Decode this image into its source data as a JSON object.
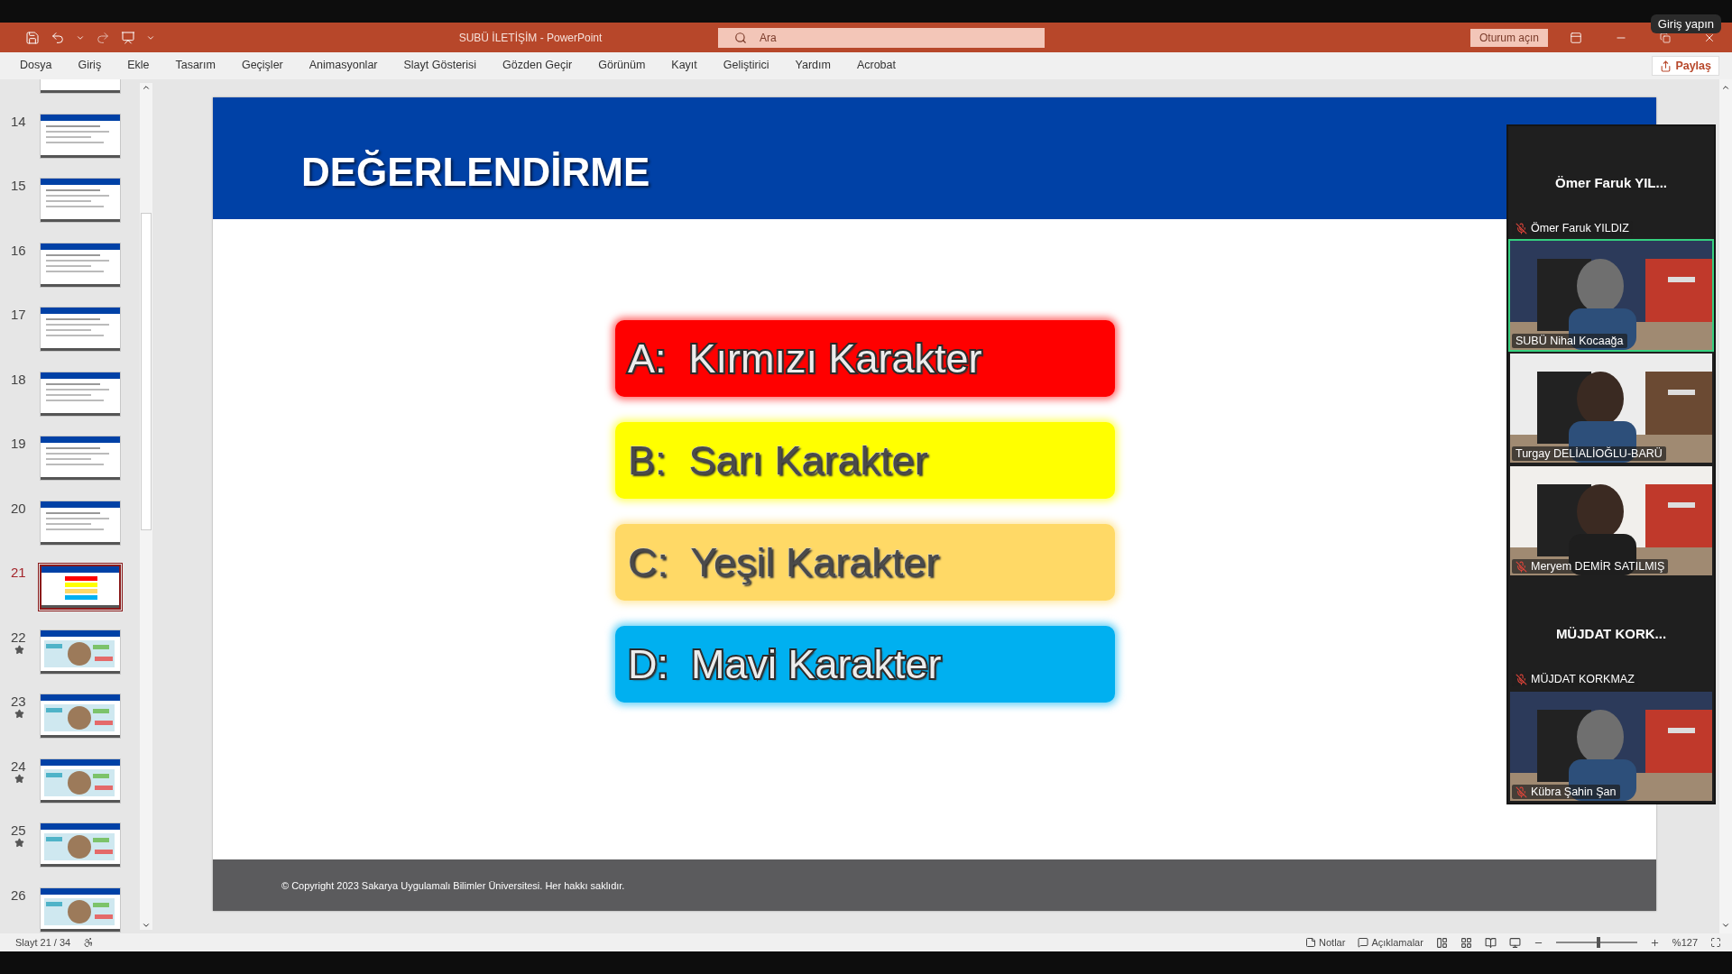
{
  "window": {
    "title": "SUBÜ İLETİŞİM  -  PowerPoint"
  },
  "search": {
    "placeholder": "Ara"
  },
  "sign_in_button": "Oturum açın",
  "tooltip": "Giriş yapın",
  "ribbon_tabs": [
    {
      "label": "Dosya",
      "selected": false
    },
    {
      "label": "Giriş",
      "selected": false
    },
    {
      "label": "Ekle",
      "selected": false
    },
    {
      "label": "Tasarım",
      "selected": false
    },
    {
      "label": "Geçişler",
      "selected": false
    },
    {
      "label": "Animasyonlar",
      "selected": false
    },
    {
      "label": "Slayt Gösterisi",
      "selected": false
    },
    {
      "label": "Gözden Geçir",
      "selected": false
    },
    {
      "label": "Görünüm",
      "selected": false
    },
    {
      "label": "Kayıt",
      "selected": false
    },
    {
      "label": "Geliştirici",
      "selected": false
    },
    {
      "label": "Yardım",
      "selected": false
    },
    {
      "label": "Acrobat",
      "selected": false
    }
  ],
  "share_button": "Paylaş",
  "thumbnails": [
    {
      "kind": "text",
      "selected": false,
      "starred": false
    },
    {
      "number": "14",
      "kind": "text",
      "selected": false,
      "starred": false
    },
    {
      "number": "15",
      "kind": "text",
      "selected": false,
      "starred": false
    },
    {
      "number": "16",
      "kind": "text",
      "selected": false,
      "starred": false
    },
    {
      "number": "17",
      "kind": "text",
      "selected": false,
      "starred": false
    },
    {
      "number": "18",
      "kind": "text",
      "selected": false,
      "starred": false
    },
    {
      "number": "19",
      "kind": "text",
      "selected": false,
      "starred": false
    },
    {
      "number": "20",
      "kind": "text",
      "selected": false,
      "starred": false
    },
    {
      "number": "21",
      "kind": "options",
      "selected": true,
      "starred": false
    },
    {
      "number": "22",
      "kind": "picture",
      "selected": false,
      "starred": true
    },
    {
      "number": "23",
      "kind": "picture",
      "selected": false,
      "starred": true
    },
    {
      "number": "24",
      "kind": "picture",
      "selected": false,
      "starred": true
    },
    {
      "number": "25",
      "kind": "picture",
      "selected": false,
      "starred": true
    },
    {
      "number": "26",
      "kind": "picture",
      "selected": false,
      "starred": false
    }
  ],
  "slide": {
    "title": "DEĞERLENDİRME",
    "options": [
      {
        "label": "A:  Kırmızı Karakter",
        "color": "#ff0000"
      },
      {
        "label": "B:  Sarı Karakter",
        "color": "#ffff00"
      },
      {
        "label": "C:  Yeşil Karakter",
        "color": "#ffd966"
      },
      {
        "label": "D:  Mavi Karakter",
        "color": "#00b0f0"
      }
    ],
    "footer": "© Copyright 2023 Sakarya Uygulamalı Bilimler Üniversitesi. Her hakkı saklıdır."
  },
  "participants": [
    {
      "kind": "name",
      "display": "Ömer Faruk YIL...",
      "name": "Ömer Faruk YILDIZ",
      "muted": true,
      "speaking": false
    },
    {
      "kind": "video",
      "name": "SUBÜ Nihal Kocaağa",
      "muted": false,
      "speaking": true
    },
    {
      "kind": "video",
      "name": "Turgay DELİALİOĞLU-BARÜ",
      "muted": false,
      "speaking": false
    },
    {
      "kind": "video",
      "name": "Meryem DEMİR SATILMIŞ",
      "muted": true,
      "speaking": false
    },
    {
      "kind": "name",
      "display": "MÜJDAT KORK...",
      "name": "MÜJDAT KORKMAZ",
      "muted": true,
      "speaking": false
    },
    {
      "kind": "video",
      "name": "Kübra Şahin Şan",
      "muted": true,
      "speaking": false
    }
  ],
  "status_bar": {
    "slide": "Slayt 21 / 34",
    "notes": "Notlar",
    "comments": "Açıklamalar",
    "zoom": "%127",
    "level": 0.52
  }
}
